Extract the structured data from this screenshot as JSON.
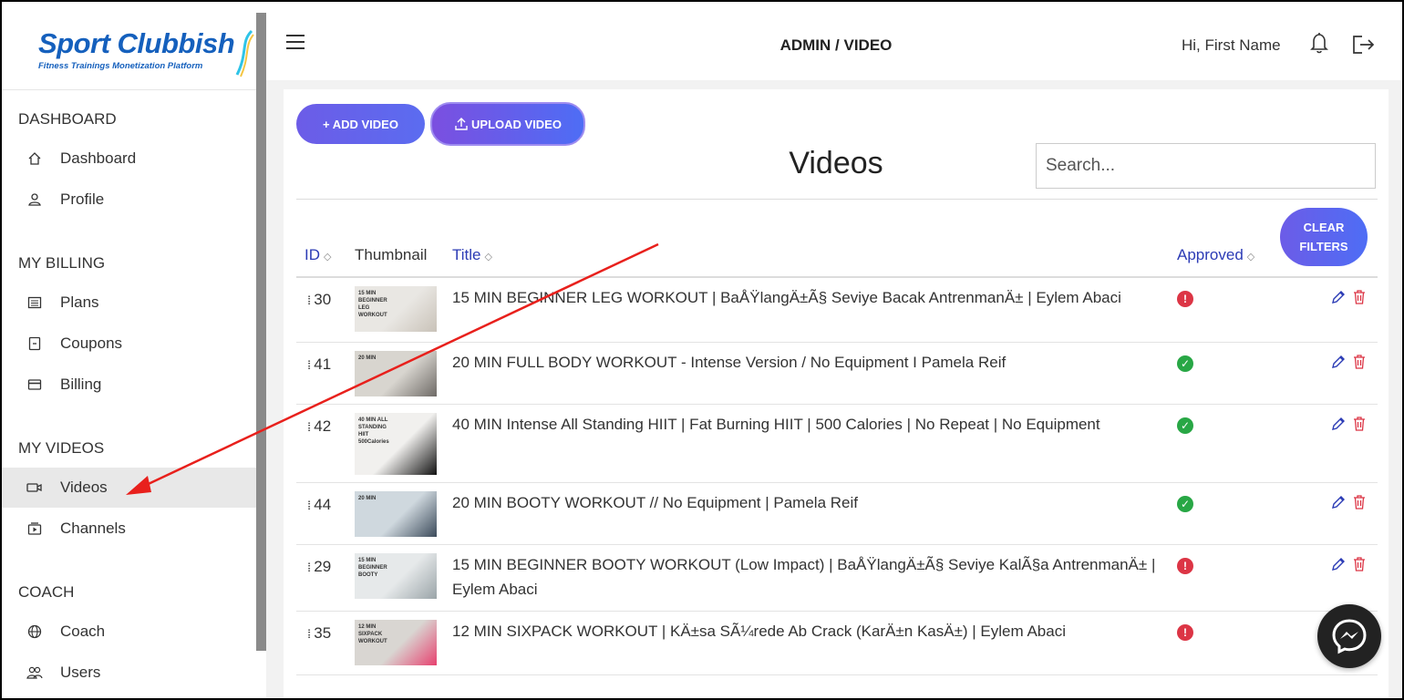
{
  "brand": {
    "name": "Sport Clubbish",
    "tagline": "Fitness Trainings Monetization Platform"
  },
  "sidebar": {
    "sections": [
      {
        "heading": "DASHBOARD",
        "items": [
          {
            "label": "Dashboard",
            "icon": "home-icon"
          },
          {
            "label": "Profile",
            "icon": "user-icon"
          }
        ]
      },
      {
        "heading": "MY BILLING",
        "items": [
          {
            "label": "Plans",
            "icon": "list-icon"
          },
          {
            "label": "Coupons",
            "icon": "coupon-icon"
          },
          {
            "label": "Billing",
            "icon": "credit-card-icon"
          }
        ]
      },
      {
        "heading": "MY VIDEOS",
        "items": [
          {
            "label": "Videos",
            "icon": "video-camera-icon",
            "active": true
          },
          {
            "label": "Channels",
            "icon": "channel-icon"
          }
        ]
      },
      {
        "heading": "COACH",
        "items": [
          {
            "label": "Coach",
            "icon": "globe-icon"
          },
          {
            "label": "Users",
            "icon": "users-icon"
          }
        ]
      }
    ]
  },
  "topbar": {
    "breadcrumb": "ADMIN / VIDEO",
    "greeting": "Hi, First Name"
  },
  "toolbar": {
    "add_label": "+ ADD VIDEO",
    "upload_label": "UPLOAD VIDEO"
  },
  "page": {
    "title": "Videos",
    "search_placeholder": "Search...",
    "clear_filters": [
      "CLEAR",
      "FILTERS"
    ]
  },
  "table": {
    "columns": {
      "id": "ID",
      "thumbnail": "Thumbnail",
      "title": "Title",
      "approved": "Approved"
    },
    "rows": [
      {
        "id": "30",
        "title": "15 MIN BEGINNER LEG WORKOUT | BaÅŸlangÄ±Ã§ Seviye Bacak AntrenmanÄ± | Eylem Abaci",
        "approved": false,
        "thumb_text": "15 MIN BEGINNER LEG WORKOUT"
      },
      {
        "id": "41",
        "title": "20 MIN FULL BODY WORKOUT - Intense Version / No Equipment I Pamela Reif",
        "approved": true,
        "thumb_text": "20 MIN"
      },
      {
        "id": "42",
        "title": "40 MIN Intense All Standing HIIT | Fat Burning HIIT | 500 Calories | No Repeat | No Equipment",
        "approved": true,
        "thumb_text": "40 MIN ALL STANDING HIIT 500Calories"
      },
      {
        "id": "44",
        "title": "20 MIN BOOTY WORKOUT // No Equipment | Pamela Reif",
        "approved": true,
        "thumb_text": "20 MIN"
      },
      {
        "id": "29",
        "title": "15 MIN BEGINNER BOOTY WORKOUT (Low Impact) | BaÅŸlangÄ±Ã§ Seviye KalÃ§a AntrenmanÄ± | Eylem Abaci",
        "approved": false,
        "thumb_text": "15 MIN BEGINNER BOOTY"
      },
      {
        "id": "35",
        "title": "12 MIN SIXPACK WORKOUT | KÄ±sa SÃ¼rede Ab Crack (KarÄ±n KasÄ±) | Eylem Abaci",
        "approved": false,
        "thumb_text": "12 MIN SIXPACK WORKOUT"
      }
    ]
  },
  "colors": {
    "brand_blue": "#1560bd",
    "accent_purple": "#6c5ce7",
    "approved_green": "#28a745",
    "pending_red": "#dc3545",
    "annotation_arrow": "#e8201c"
  }
}
